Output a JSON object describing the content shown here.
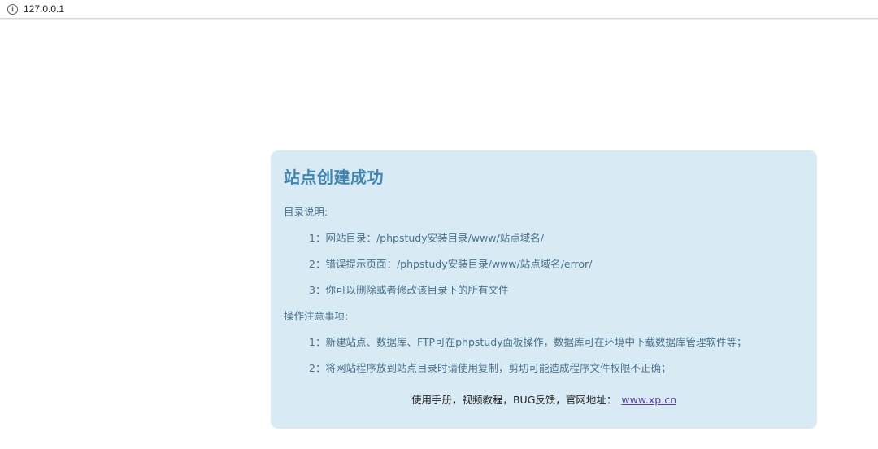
{
  "browser": {
    "url": "127.0.0.1",
    "info_icon": "info-icon"
  },
  "panel": {
    "title": "站点创建成功",
    "dir_heading": "目录说明:",
    "dir_items": [
      "1：网站目录：/phpstudy安装目录/www/站点域名/",
      "2：错误提示页面：/phpstudy安装目录/www/站点域名/error/",
      "3：你可以删除或者修改该目录下的所有文件"
    ],
    "ops_heading": "操作注意事项:",
    "ops_items": [
      "1：新建站点、数据库、FTP可在phpstudy面板操作，数据库可在环境中下载数据库管理软件等；",
      "2：将网站程序放到站点目录时请使用复制，剪切可能造成程序文件权限不正确；"
    ],
    "footer_text": "使用手册，视频教程，BUG反馈，官网地址：",
    "footer_link": "www.xp.cn"
  },
  "colors": {
    "panel_bg": "#d8ebf5",
    "title": "#3f87b0",
    "body_text": "#4a7089",
    "link": "#5b3ea0"
  }
}
